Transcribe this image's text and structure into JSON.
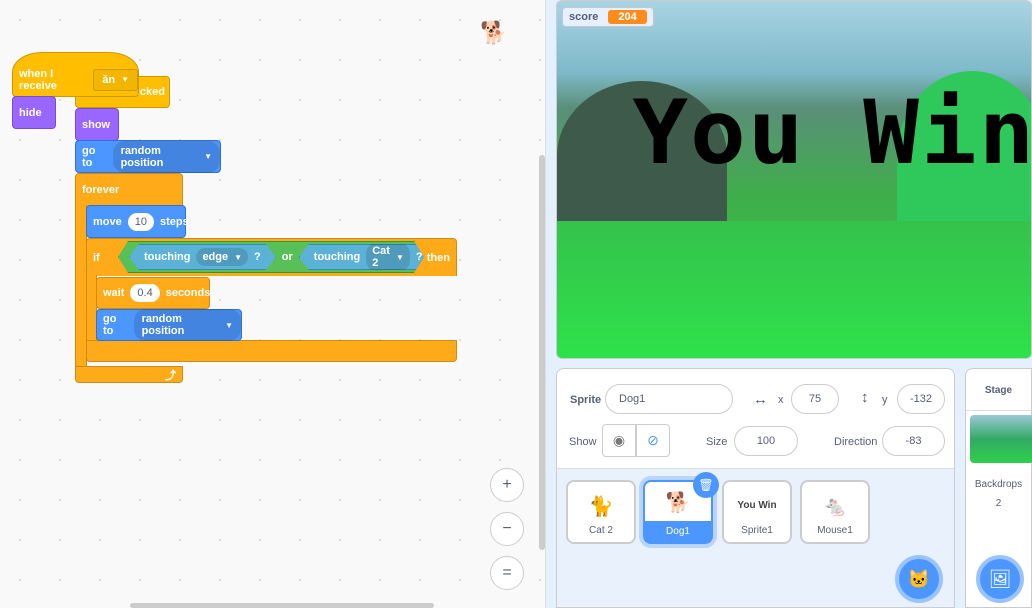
{
  "code": {
    "hat_receive": {
      "label": "when I receive",
      "message": "ǎn"
    },
    "hat_clicked": {
      "label": "licked"
    },
    "hide": "hide",
    "show": "show",
    "goto1": {
      "label": "go to",
      "target": "random position"
    },
    "forever": "forever",
    "move": {
      "label": "move",
      "value": "10",
      "unit": "steps"
    },
    "if": {
      "label": "if",
      "then": "then",
      "touch1": "touching",
      "obj1": "edge",
      "q": "?",
      "or": "or",
      "touch2": "touching",
      "obj2": "Cat 2"
    },
    "wait": {
      "label": "wait",
      "value": "0.4",
      "unit": "seconds"
    },
    "goto2": {
      "label": "go to",
      "target": "random position"
    },
    "zoom_in": "+",
    "zoom_out": "−",
    "reset": "="
  },
  "stage": {
    "monitor_label": "score",
    "monitor_value": "204",
    "text": "You Win"
  },
  "sprite_info": {
    "sprite_label": "Sprite",
    "sprite_name": "Dog1",
    "x_label": "x",
    "x": "75",
    "y_label": "y",
    "y": "-132",
    "show_label": "Show",
    "size_label": "Size",
    "size": "100",
    "direction_label": "Direction",
    "direction": "-83"
  },
  "sprites": [
    {
      "name": "Cat 2"
    },
    {
      "name": "Dog1",
      "selected": true
    },
    {
      "name": "Sprite1",
      "thumb_text": "You Win"
    },
    {
      "name": "Mouse1"
    }
  ],
  "stage_pane": {
    "title": "Stage",
    "backdrops_label": "Backdrops",
    "backdrops_count": "2"
  },
  "colors": {
    "events": "#ffbf00",
    "looks": "#9966ff",
    "motion": "#4c97ff",
    "control": "#ffab19",
    "operators": "#59c059",
    "sensing": "#5cb1d6"
  }
}
